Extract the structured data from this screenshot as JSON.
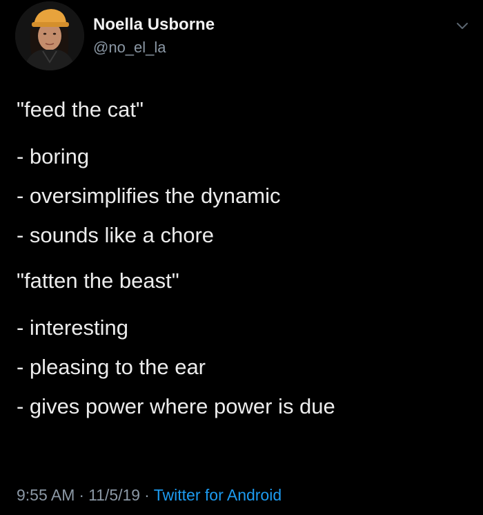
{
  "tweet": {
    "author": {
      "name": "Noella Usborne",
      "handle": "@no_el_la"
    },
    "body": {
      "quote1": "\"feed the cat\"",
      "items1": [
        "- boring",
        "- oversimplifies the dynamic",
        "- sounds like a chore"
      ],
      "quote2": "\"fatten the beast\"",
      "items2": [
        "- interesting",
        "- pleasing to the ear",
        "- gives power where power is due"
      ]
    },
    "meta": {
      "time": "9:55 AM",
      "date": "11/5/19",
      "source": "Twitter for Android",
      "separator": "·"
    }
  },
  "colors": {
    "background": "#000000",
    "text": "#ececec",
    "muted": "#8b98a5",
    "link": "#1d9bf0",
    "hat": "#e8a33c"
  },
  "icons": {
    "menu": "chevron-down-icon"
  }
}
